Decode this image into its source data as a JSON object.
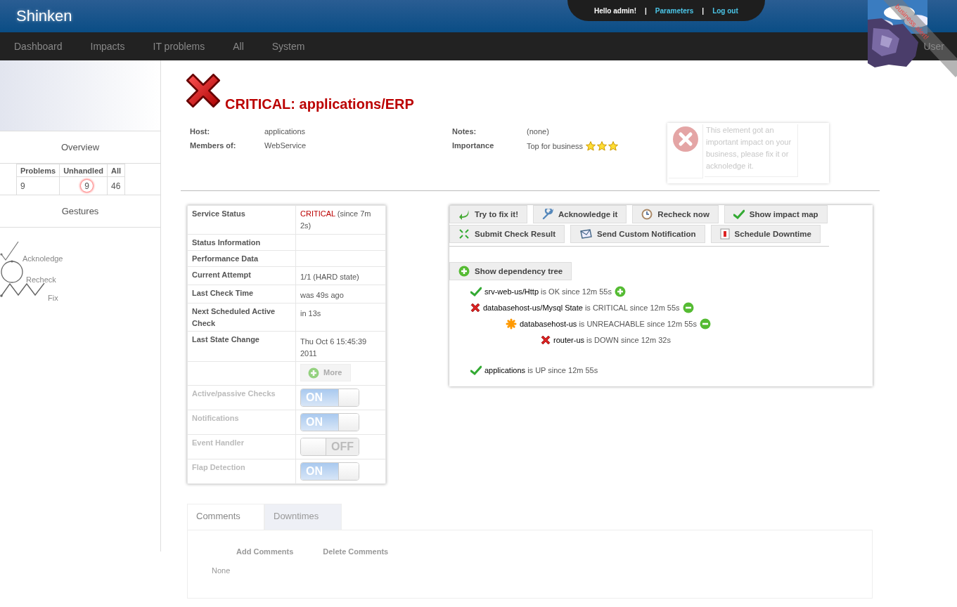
{
  "header": {
    "title": "Shinken",
    "greeting": "Hello admin!",
    "links": [
      {
        "separator": "|",
        "label": "Parameters"
      },
      {
        "separator": "|",
        "label": "Log out"
      }
    ]
  },
  "nav": {
    "items": [
      {
        "label": "Dashboard"
      },
      {
        "label": "Impacts"
      },
      {
        "label": "IT problems"
      },
      {
        "label": "All"
      },
      {
        "label": "System"
      }
    ],
    "user": "User"
  },
  "alert": {
    "text": "business alert!"
  },
  "sidebar": {
    "overview": {
      "title": "Overview",
      "columns": [
        "Problems",
        "Unhandled",
        "All"
      ],
      "values": [
        {
          "text": "9",
          "highlighted": false
        },
        {
          "text": "9",
          "highlighted": true
        },
        {
          "text": "46",
          "highlighted": false
        }
      ]
    },
    "gestures": {
      "title": "Gestures",
      "items": [
        {
          "kind": "check",
          "label": "Acknoledge"
        },
        {
          "kind": "circle",
          "label": "Recheck"
        },
        {
          "kind": "zigzag",
          "label": "Fix"
        }
      ]
    }
  },
  "element": {
    "kind": "critical",
    "title": "CRITICAL: applications/ERP",
    "fields": [
      {
        "label": "Host:",
        "value": "applications"
      },
      {
        "label": "Notes:",
        "value": "(none)"
      },
      {
        "label": "Members of:",
        "value": "WebService"
      }
    ],
    "importance": {
      "label": "Importance",
      "value": "Top for business",
      "stars": 3
    },
    "notice": "This element got an important impact on your business, please fix it or acknoledge it."
  },
  "status": {
    "rows": [
      {
        "kind": "state",
        "label": "Service Status",
        "value": "CRITICAL",
        "extra": "(since 7m 2s)"
      },
      {
        "kind": "text",
        "label": "Status Information"
      },
      {
        "kind": "text",
        "label": "Performance Data"
      },
      {
        "kind": "text",
        "label": "Current Attempt",
        "value": "1/1 (HARD state)"
      },
      {
        "kind": "text",
        "label": "Last Check Time",
        "value": "was 49s ago"
      },
      {
        "kind": "text",
        "label": "Next Scheduled Active Check",
        "value": "in 13s"
      },
      {
        "kind": "text",
        "label": "Last State Change",
        "value": "Thu Oct 6 15:45:39 2011"
      },
      {
        "kind": "button",
        "value": "More"
      },
      {
        "kind": "toggle",
        "label": "Active/passive Checks",
        "on": true,
        "value": "ON"
      },
      {
        "kind": "toggle",
        "label": "Notifications",
        "on": true,
        "value": "ON"
      },
      {
        "kind": "toggle",
        "label": "Event Handler",
        "on": false,
        "value": "OFF"
      },
      {
        "kind": "toggle",
        "label": "Flap Detection",
        "on": true,
        "value": "ON"
      }
    ]
  },
  "actions": {
    "buttons": [
      {
        "kind": "fix",
        "label": "Try to fix it!"
      },
      {
        "kind": "acknowledge",
        "label": "Acknowledge it"
      },
      {
        "kind": "recheck",
        "label": "Recheck now"
      },
      {
        "kind": "impact",
        "label": "Show impact map"
      },
      {
        "kind": "submit",
        "label": "Submit Check Result"
      },
      {
        "kind": "notify",
        "label": "Send Custom Notification"
      },
      {
        "kind": "downtime",
        "label": "Schedule Downtime"
      }
    ],
    "dependency_button": "Show dependency tree",
    "tree": [
      {
        "kind": "ok",
        "name": "srv-web-us/Http",
        "status": "is OK since 12m 55s",
        "expanded": false
      },
      {
        "kind": "critical",
        "name": "databasehost-us/Mysql State",
        "status": "is CRITICAL since 12m 55s",
        "expanded": true,
        "children": [
          {
            "kind": "unreachable",
            "name": "databasehost-us",
            "status": "is UNREACHABLE since 12m 55s",
            "expanded": true,
            "children": [
              {
                "kind": "critical",
                "name": "router-us",
                "status": "is DOWN since 12m 32s"
              }
            ]
          }
        ]
      },
      {
        "kind": "ok",
        "name": "applications",
        "status": "is UP since 12m 55s"
      }
    ]
  },
  "comments": {
    "tabs": [
      {
        "label": "Comments",
        "selected": true
      },
      {
        "label": "Downtimes",
        "selected": false
      }
    ],
    "actions": [
      {
        "label": "Add Comments"
      },
      {
        "label": "Delete Comments"
      }
    ],
    "empty": "None"
  }
}
